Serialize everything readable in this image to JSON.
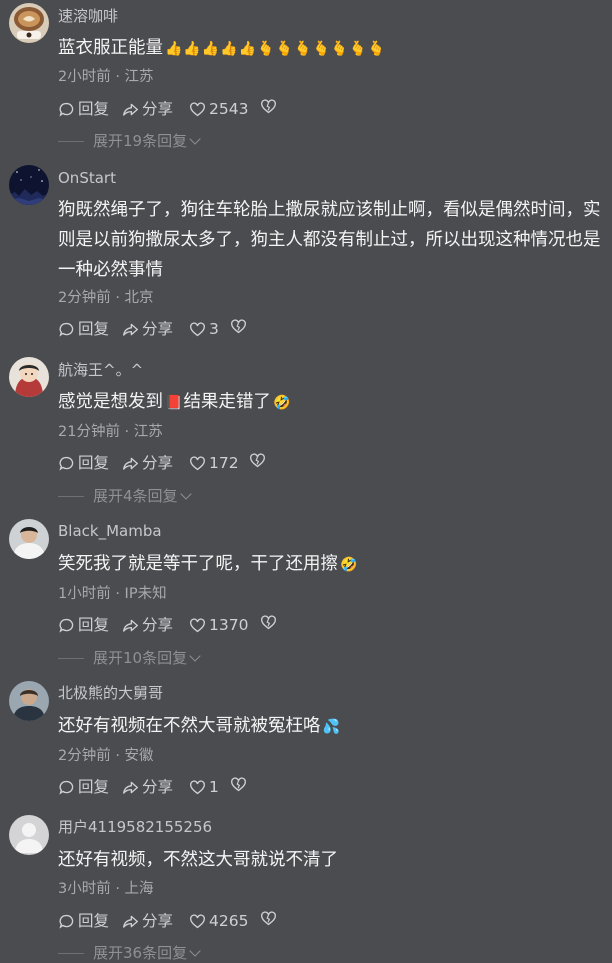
{
  "comments": [
    {
      "username": "速溶咖啡",
      "text": "蓝衣服正能量",
      "emoji": "👍👍👍👍👍🫰🫰🫰🫰🫰🫰🫰",
      "time_location": "2小时前 · 江苏",
      "reply_label": "回复",
      "share_label": "分享",
      "likes": "2543",
      "expand_label": "展开19条回复",
      "avatar": "coffee-cup-avatar"
    },
    {
      "username": "OnStart",
      "text": "狗既然绳子了，狗往车轮胎上撒尿就应该制止啊，看似是偶然时间，实则是以前狗撒尿太多了，狗主人都没有制止过，所以出现这种情况也是一种必然事情",
      "emoji": "",
      "time_location": "2分钟前 · 北京",
      "reply_label": "回复",
      "share_label": "分享",
      "likes": "3",
      "expand_label": "",
      "avatar": "night-sky-avatar"
    },
    {
      "username": "航海王^。^",
      "text": "感觉是想发到",
      "text_after": "结果走错了",
      "emoji_mid": "📕",
      "emoji": "🤣",
      "time_location": "21分钟前 · 江苏",
      "reply_label": "回复",
      "share_label": "分享",
      "likes": "172",
      "expand_label": "展开4条回复",
      "avatar": "anime-character-avatar"
    },
    {
      "username": "Black_Mamba",
      "text": "笑死我了就是等干了呢，干了还用擦",
      "emoji": "🤣",
      "time_location": "1小时前 · IP未知",
      "reply_label": "回复",
      "share_label": "分享",
      "likes": "1370",
      "expand_label": "展开10条回复",
      "avatar": "person-photo-avatar"
    },
    {
      "username": "北极熊的大舅哥",
      "text": "还好有视频在不然大哥就被冤枉咯",
      "emoji": "💦",
      "time_location": "2分钟前 · 安徽",
      "reply_label": "回复",
      "share_label": "分享",
      "likes": "1",
      "expand_label": "",
      "avatar": "man-portrait-avatar"
    },
    {
      "username": "用户4119582155256",
      "text": "还好有视频，不然这大哥就说不清了",
      "emoji": "",
      "time_location": "3小时前 · 上海",
      "reply_label": "回复",
      "share_label": "分享",
      "likes": "4265",
      "expand_label": "展开36条回复",
      "avatar": "default-user-avatar"
    }
  ],
  "colors": {
    "background": "#4b4c50",
    "text": "#f4f4f5",
    "secondary": "#a8a9ad"
  }
}
